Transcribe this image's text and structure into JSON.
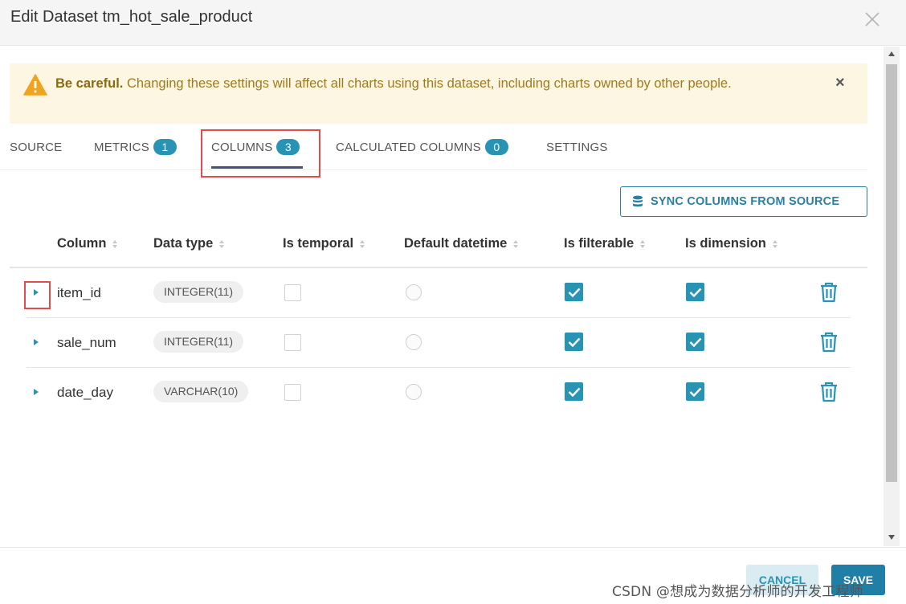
{
  "modal": {
    "title": "Edit Dataset tm_hot_sale_product"
  },
  "alert": {
    "strong": "Be careful.",
    "message": "Changing these settings will affect all charts using this dataset, including charts owned by other people."
  },
  "tabs": [
    {
      "label": "SOURCE"
    },
    {
      "label": "METRICS",
      "badge": "1"
    },
    {
      "label": "COLUMNS",
      "badge": "3"
    },
    {
      "label": "CALCULATED COLUMNS",
      "badge": "0"
    },
    {
      "label": "SETTINGS"
    }
  ],
  "sync_button": {
    "label": "SYNC COLUMNS FROM SOURCE"
  },
  "table": {
    "headers": [
      "Column",
      "Data type",
      "Is temporal",
      "Default datetime",
      "Is filterable",
      "Is dimension"
    ],
    "rows": [
      {
        "column": "item_id",
        "type": "INTEGER(11)"
      },
      {
        "column": "sale_num",
        "type": "INTEGER(11)"
      },
      {
        "column": "date_day",
        "type": "VARCHAR(10)"
      }
    ]
  },
  "footer": {
    "cancel": "CANCEL",
    "save": "SAVE"
  },
  "watermark": "CSDN @想成为数据分析师的开发工程师",
  "colors": {
    "accent": "#2893b3",
    "primary": "#1f7fa6",
    "warning_bg": "#fcf6e3",
    "highlight": "#e54b4b"
  }
}
